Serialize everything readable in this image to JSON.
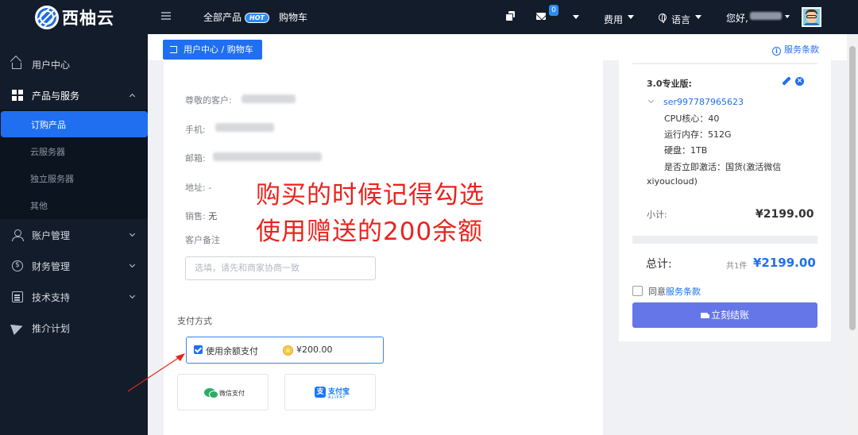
{
  "brand": {
    "name": "西柚云"
  },
  "topnav": {
    "all_products": "全部产品",
    "hot_badge": "HOT",
    "cart": "购物车",
    "message_count": "0",
    "fees": "费用",
    "language": "语言",
    "greeting": "您好,"
  },
  "sidebar": {
    "items": [
      {
        "label": "用户中心",
        "icon": "home-icon"
      },
      {
        "label": "产品与服务",
        "icon": "grid-icon",
        "expanded": true
      },
      {
        "label": "账户管理",
        "icon": "user-icon"
      },
      {
        "label": "财务管理",
        "icon": "money-icon"
      },
      {
        "label": "技术支持",
        "icon": "doc-icon"
      },
      {
        "label": "推介计划",
        "icon": "send-icon"
      }
    ],
    "subitems": [
      {
        "label": "订购产品",
        "active": true
      },
      {
        "label": "云服务器"
      },
      {
        "label": "独立服务器"
      },
      {
        "label": "其他"
      }
    ]
  },
  "breadcrumb": "用户中心 / 购物车",
  "terms_link": "服务条款",
  "customer": {
    "greeting_label": "尊敬的客户:",
    "phone_label": "手机:",
    "email_label": "邮箱:",
    "address_label": "地址:",
    "address_value": "-",
    "sales_label": "销售:",
    "sales_value": "无",
    "remark_label": "客户备注",
    "remark_placeholder": "选填，请先和商家协商一致"
  },
  "payment": {
    "title": "支付方式",
    "balance_label": "使用余额支付",
    "balance_amount": "¥200.00",
    "balance_checked": true,
    "wechat_label": "微信支付",
    "alipay_label": "支付宝",
    "alipay_sub": "ALIPAY"
  },
  "annotation": {
    "line1": "购买的时候记得勾选",
    "line2": "使用赠送的200余额"
  },
  "order": {
    "product_name": "3.0专业版:",
    "server_id": "ser997787965623",
    "cpu": "CPU核心：40",
    "ram": "运行内存：512G",
    "disk": "硬盘：1TB",
    "activate": "是否立即激活：国货(激活微信",
    "activate_cont": "xiyoucloud)",
    "subtotal_label": "小计:",
    "subtotal_value": "¥2199.00",
    "total_label": "总计:",
    "total_count": "共1件",
    "total_value": "¥2199.00",
    "agree_prefix": "同意",
    "agree_link": "服务条款",
    "checkout": "立刻结账"
  },
  "colors": {
    "accent": "#1f6ff0",
    "sidebar_bg": "#131c2a",
    "annotation": "#e8231d",
    "checkout_btn": "#6576e8"
  }
}
